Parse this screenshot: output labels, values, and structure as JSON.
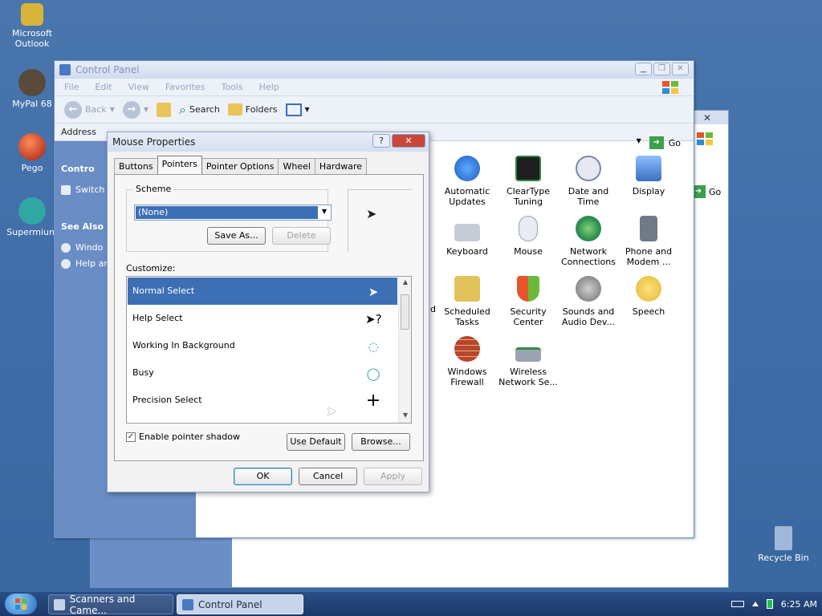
{
  "desktop": {
    "icons": [
      {
        "label": "Microsoft Outlook",
        "icon": "outlook-icon",
        "color": "#d8b33a"
      },
      {
        "label": "MyPal 68",
        "icon": "raccoon-icon",
        "color": "#5a4a3a"
      },
      {
        "label": "Pego",
        "icon": "pego-icon",
        "color": "#c2341f"
      },
      {
        "label": "Supermium",
        "icon": "supermium-icon",
        "color": "#2fa7a3"
      },
      {
        "label": "Recycle Bin",
        "icon": "recycle-bin-icon",
        "color": "#9fb7d8"
      }
    ]
  },
  "back_window": {
    "go_label": "Go"
  },
  "control_panel": {
    "title": "Control Panel",
    "menu": [
      "File",
      "Edit",
      "View",
      "Favorites",
      "Tools",
      "Help"
    ],
    "toolbar": {
      "back": "Back",
      "search": "Search",
      "folders": "Folders"
    },
    "address_label": "Address",
    "go_label": "Go",
    "left_panel": {
      "section1_title": "Contro",
      "section1_link": "Switch",
      "see_also": "See Also",
      "links": [
        "Windo",
        "Help ar"
      ]
    },
    "items": [
      {
        "label": "Automatic Updates",
        "icon": "windows-update-icon",
        "color": "#2b6fd1"
      },
      {
        "label": "ClearType Tuning",
        "icon": "cleartype-icon",
        "color": "#1f1f1f"
      },
      {
        "label": "Date and Time",
        "icon": "clock-icon",
        "color": "#7a8aa8"
      },
      {
        "label": "Display",
        "icon": "display-icon",
        "color": "#3a6fc2"
      },
      {
        "label": "Keyboard",
        "icon": "keyboard-icon",
        "color": "#9aa3b2"
      },
      {
        "label": "Mouse",
        "icon": "mouse-icon",
        "color": "#cfd5df"
      },
      {
        "label": "Network Connections",
        "icon": "network-icon",
        "color": "#2e8f4a"
      },
      {
        "label": "Phone and Modem ...",
        "icon": "phone-icon",
        "color": "#6f7a86"
      },
      {
        "label": "Scheduled Tasks",
        "icon": "scheduled-tasks-icon",
        "color": "#e2c25a"
      },
      {
        "label": "Security Center",
        "icon": "shield-icon",
        "color": "#2d7bc9"
      },
      {
        "label": "Sounds and Audio Dev...",
        "icon": "speaker-icon",
        "color": "#8c8c8c"
      },
      {
        "label": "Speech",
        "icon": "speech-icon",
        "color": "#e3b93a"
      },
      {
        "label": "Windows Firewall",
        "icon": "firewall-icon",
        "color": "#b8452a"
      },
      {
        "label": "Wireless Network Se...",
        "icon": "wireless-icon",
        "color": "#3a8a4a"
      }
    ],
    "partial_label": "d"
  },
  "dialog": {
    "title": "Mouse Properties",
    "tabs": [
      "Buttons",
      "Pointers",
      "Pointer Options",
      "Wheel",
      "Hardware"
    ],
    "active_tab": "Pointers",
    "scheme_label": "Scheme",
    "scheme_value": "(None)",
    "save_as": "Save As...",
    "delete": "Delete",
    "customize_label": "Customize:",
    "pointers": [
      {
        "name": "Normal Select",
        "selected": true
      },
      {
        "name": "Help Select",
        "selected": false
      },
      {
        "name": "Working In Background",
        "selected": false
      },
      {
        "name": "Busy",
        "selected": false
      },
      {
        "name": "Precision Select",
        "selected": false
      }
    ],
    "shadow_label": "Enable pointer shadow",
    "shadow_checked": true,
    "use_default": "Use Default",
    "browse": "Browse...",
    "ok": "OK",
    "cancel": "Cancel",
    "apply": "Apply"
  },
  "taskbar": {
    "tasks": [
      {
        "label": "Scanners and Came...",
        "active": false
      },
      {
        "label": "Control Panel",
        "active": true
      }
    ],
    "clock": "6:25 AM"
  },
  "colors": {
    "selection": "#3d6fb5",
    "desktop": "#3f6da8",
    "sidebar": "#6b8dc5"
  }
}
